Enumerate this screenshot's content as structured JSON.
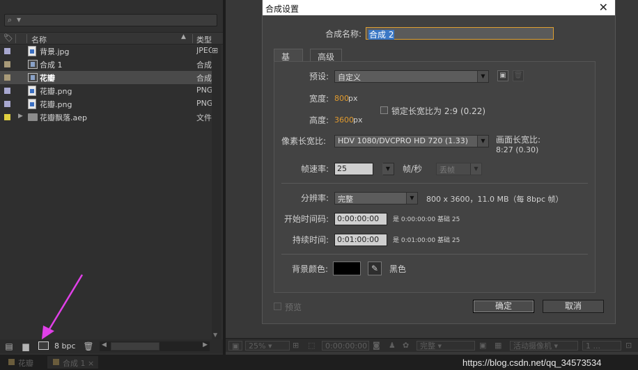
{
  "project_panel": {
    "columns": {
      "name": "名称",
      "type": "类型"
    },
    "items": [
      {
        "name": "背景.jpg",
        "type": "JPEG",
        "label_color": "#a8a8d0",
        "icon": "image-file-icon",
        "selected": false
      },
      {
        "name": "合成 1",
        "type": "合成",
        "label_color": "#a89a78",
        "icon": "composition-icon",
        "selected": false
      },
      {
        "name": "花瓣",
        "type": "合成",
        "label_color": "#a89a78",
        "icon": "composition-icon",
        "selected": true
      },
      {
        "name": "花瓣.png",
        "type": "PNG",
        "label_color": "#a8a8d0",
        "icon": "image-file-icon",
        "selected": false
      },
      {
        "name": "花瓣.png",
        "type": "PNG",
        "label_color": "#a8a8d0",
        "icon": "image-file-icon",
        "selected": false
      },
      {
        "name": "花瓣飘落.aep",
        "type": "文件",
        "label_color": "#e0d040",
        "icon": "folder-icon",
        "selected": false
      }
    ],
    "bpc_label": "8 bpc"
  },
  "dialog": {
    "title": "合成设置",
    "comp_name_label": "合成名称:",
    "comp_name_value": "合成 2",
    "tabs": [
      "基本",
      "高级"
    ],
    "preset_label": "预设:",
    "preset_value": "自定义",
    "width_label": "宽度:",
    "width_value": "800",
    "height_label": "高度:",
    "height_value": "3600",
    "px": "px",
    "lock_aspect_label": "锁定长宽比为 2:9 (0.22)",
    "pixel_aspect_label": "像素长宽比:",
    "pixel_aspect_value": "HDV 1080/DVCPRO HD 720 (1.33)",
    "frame_aspect_label": "画面长宽比:",
    "frame_aspect_value": "8:27 (0.30)",
    "frame_rate_label": "帧速率:",
    "frame_rate_value": "25",
    "fps_unit": "帧/秒",
    "drop_frame_value": "丢帧",
    "resolution_label": "分辨率:",
    "resolution_value": "完整",
    "resolution_info": "800 x 3600，11.0 MB（每 8bpc 帧）",
    "start_tc_label": "开始时间码:",
    "start_tc_value": "0:00:00:00",
    "start_tc_info": "是 0:00:00:00",
    "start_base": "基础 25",
    "duration_label": "持续时间:",
    "duration_value": "0:01:00:00",
    "duration_info": "是 0:01:00:00",
    "duration_base": "基础 25",
    "bg_color_label": "背景颜色:",
    "bg_color_name": "黑色",
    "bg_color": "#000000",
    "preview_label": "预览",
    "ok_label": "确定",
    "cancel_label": "取消"
  },
  "viewer_bar": {
    "zoom": "25%",
    "timecode": "0:00:00:00",
    "resolution": "完整",
    "camera": "活动摄像机",
    "views": "1 ..."
  },
  "bottom_tabs": [
    {
      "label": "花瓣",
      "active": false
    },
    {
      "label": "合成 1",
      "active": true
    }
  ],
  "watermark": "https://blog.csdn.net/qq_34573534"
}
